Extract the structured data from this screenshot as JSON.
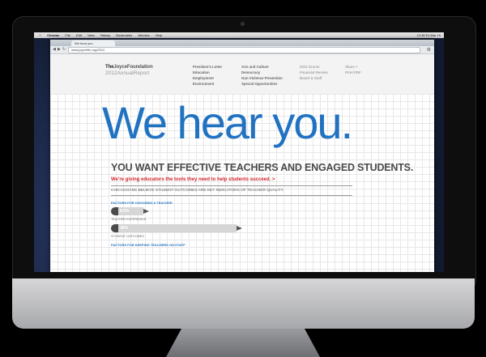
{
  "menubar": {
    "app": "Chrome",
    "items": [
      "File",
      "Edit",
      "View",
      "History",
      "Bookmarks",
      "Window",
      "Help"
    ],
    "clock": "12:35 Fri Mar 15"
  },
  "browser": {
    "tab_title": "We hear you",
    "url": "www.joycefdn.org/2012"
  },
  "site": {
    "logo_prefix": "The",
    "logo_main": "JoyceFoundation",
    "logo_sub": "2012AnnualReport",
    "nav_col1": [
      "President's Letter",
      "Education",
      "Employment",
      "Environment"
    ],
    "nav_col2": [
      "Arts and Culture",
      "Democracy",
      "Gun Violence Prevention",
      "Special Opportunities"
    ],
    "nav_col3": [
      "2012 Grants",
      "Financial Review",
      "Board & Staff"
    ],
    "nav_col4": [
      "Share +",
      "Print PDF"
    ]
  },
  "main": {
    "headline": "We hear you.",
    "subhead": "YOU WANT EFFECTIVE TEACHERS AND ENGAGED STUDENTS.",
    "tagline": "We're giving educators the tools they need to help students succeed.  >",
    "section_title": "CHICAGOANS BELIEVE STUDENT OUTCOMES ARE KEY INDICATORS OF TEACHER QUALITY",
    "factor_choosing": "FACTORS FOR CHOOSING A TEACHER",
    "factor_keeping": "FACTORS FOR KEEPING TEACHERS ON STAFF",
    "bars": [
      {
        "value_text": "8.5%",
        "label": "TEACHER EXPERIENCE",
        "percent": 8.5
      },
      {
        "value_text": "36%",
        "label": "STUDENT OUTCOMES",
        "percent": 36
      }
    ]
  },
  "colors": {
    "headline_blue": "#2173c2",
    "accent_red": "#d2232a"
  }
}
